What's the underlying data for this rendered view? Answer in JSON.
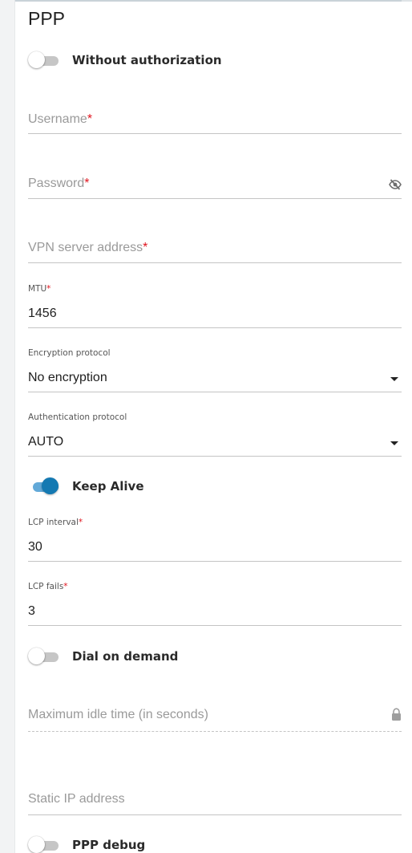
{
  "section": {
    "title": "PPP"
  },
  "toggles": {
    "without_authorization": {
      "label": "Without authorization",
      "state": "off"
    },
    "keep_alive": {
      "label": "Keep Alive",
      "state": "on"
    },
    "dial_on_demand": {
      "label": "Dial on demand",
      "state": "off"
    },
    "ppp_debug": {
      "label": "PPP debug",
      "state": "off"
    }
  },
  "fields": {
    "username": {
      "placeholder": "Username",
      "required_mark": "*",
      "value": ""
    },
    "password": {
      "placeholder": "Password",
      "required_mark": "*",
      "value": "",
      "icon": "eye-slash-icon"
    },
    "vpn_server": {
      "placeholder": "VPN server address",
      "required_mark": "*",
      "value": ""
    },
    "mtu": {
      "label": "MTU",
      "required_mark": "*",
      "value": "1456"
    },
    "encryption": {
      "label": "Encryption protocol",
      "value": "No encryption",
      "icon": "caret-down-icon"
    },
    "authentication": {
      "label": "Authentication protocol",
      "value": "AUTO",
      "icon": "caret-down-icon"
    },
    "lcp_interval": {
      "label": "LCP interval",
      "required_mark": "*",
      "value": "30"
    },
    "lcp_fails": {
      "label": "LCP fails",
      "required_mark": "*",
      "value": "3"
    },
    "max_idle": {
      "placeholder": "Maximum idle time (in seconds)",
      "value": "",
      "icon": "lock-icon",
      "disabled": true
    },
    "static_ip": {
      "placeholder": "Static IP address",
      "value": ""
    }
  },
  "colors": {
    "accent": "#1479b2",
    "accent_track": "#62a9d8",
    "required": "#e0141e",
    "placeholder": "#9a9a9a",
    "underline": "#c4c4c4"
  }
}
